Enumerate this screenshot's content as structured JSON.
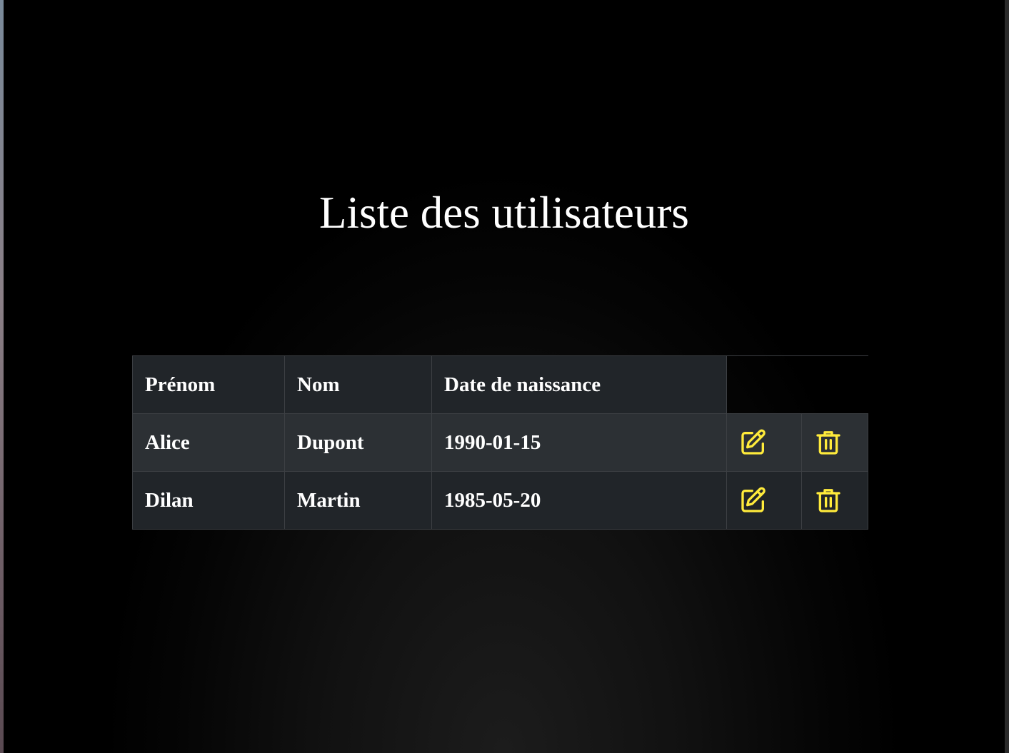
{
  "page": {
    "title": "Liste des utilisateurs"
  },
  "table": {
    "headers": [
      "Prénom",
      "Nom",
      "Date de naissance"
    ],
    "rows": [
      {
        "prenom": "Alice",
        "nom": "Dupont",
        "date_naissance": "1990-01-15"
      },
      {
        "prenom": "Dilan",
        "nom": "Martin",
        "date_naissance": "1985-05-20"
      }
    ],
    "actions": {
      "edit_icon": "edit-icon",
      "delete_icon": "trash-icon"
    }
  },
  "colors": {
    "background": "#000000",
    "header_bg": "#212529",
    "row_odd_bg": "#2c3034",
    "row_even_bg": "#212529",
    "border": "#3c3f43",
    "text": "#ffffff",
    "icon_accent": "#ffeb3b"
  }
}
